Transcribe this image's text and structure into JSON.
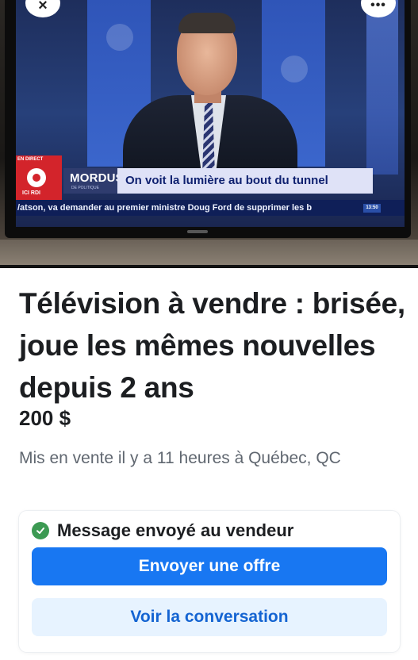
{
  "photo": {
    "chrome": {
      "close_glyph": "×",
      "more_glyph": "•••"
    },
    "broadcast": {
      "live_tag": "EN DIRECT",
      "network": "ICI RDI",
      "show_name": "MORDUS",
      "show_sub": "DE POLITIQUE",
      "headline": "On voit la lumière au bout du tunnel",
      "crawl": "/atson, va demander au premier ministre Doug Ford de supprimer les b",
      "crawl_time": "13:50"
    }
  },
  "listing": {
    "title": "Télévision à vendre : brisée, joue les mêmes nouvelles depuis 2 ans",
    "price": "200 $",
    "meta": "Mis en vente il y a 11 heures à Québec, QC"
  },
  "message_card": {
    "status_icon": "check-circle-icon",
    "status_text": "Message envoyé au vendeur",
    "primary_button": "Envoyer une offre",
    "secondary_button": "Voir la conversation"
  },
  "colors": {
    "primary": "#1877f2",
    "secondary_bg": "#e7f3ff",
    "success": "#3c9a53",
    "headline_bg": "#dfe2f7",
    "crawl_bg": "#0f1f58",
    "logo_red": "#d3242b"
  }
}
